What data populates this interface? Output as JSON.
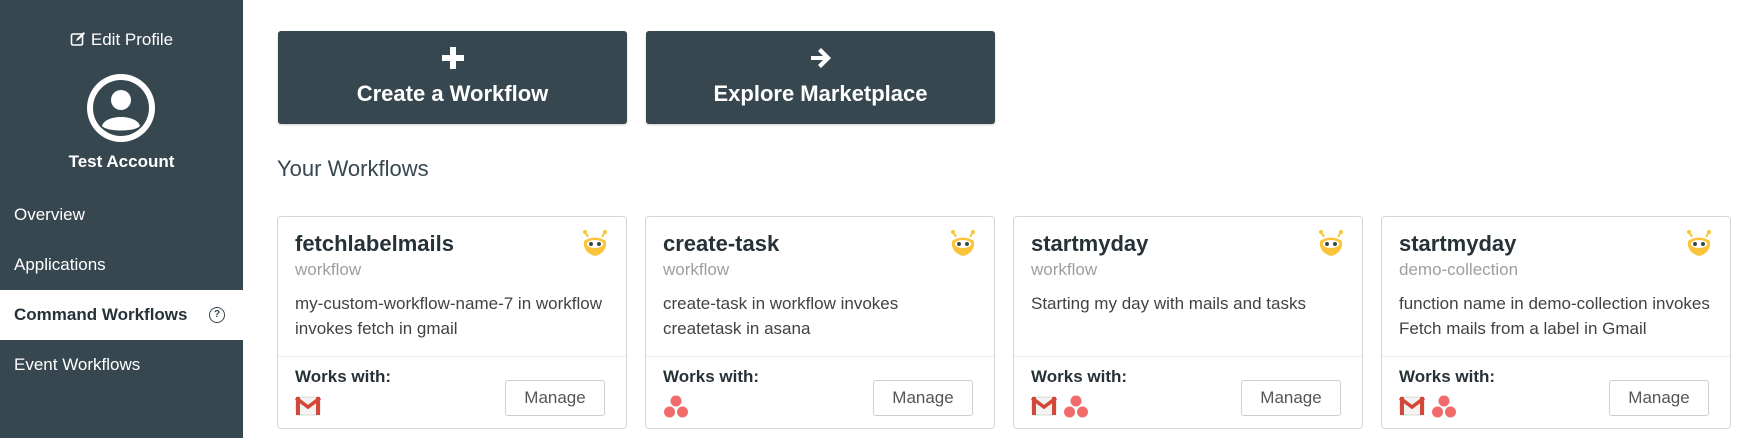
{
  "sidebar": {
    "edit_profile": "Edit Profile",
    "account_name": "Test Account",
    "items": [
      {
        "label": "Overview"
      },
      {
        "label": "Applications"
      },
      {
        "label": "Command Workflows",
        "active": true
      },
      {
        "label": "Event Workflows"
      }
    ],
    "help_glyph": "?"
  },
  "actions": {
    "create_label": "Create a Workflow",
    "explore_label": "Explore Marketplace"
  },
  "section_title": "Your Workflows",
  "workflows": [
    {
      "name": "fetchlabelmails",
      "collection": "workflow",
      "description": "my-custom-workflow-name-7 in workflow invokes fetch in gmail",
      "works_with_label": "Works with:",
      "apps": [
        "gmail-icon"
      ],
      "manage_label": "Manage"
    },
    {
      "name": "create-task",
      "collection": "workflow",
      "description": "create-task in workflow invokes createtask in asana",
      "works_with_label": "Works with:",
      "apps": [
        "asana-icon"
      ],
      "manage_label": "Manage"
    },
    {
      "name": "startmyday",
      "collection": "workflow",
      "description": "Starting my day with mails and tasks",
      "works_with_label": "Works with:",
      "apps": [
        "gmail-icon",
        "asana-icon"
      ],
      "manage_label": "Manage"
    },
    {
      "name": "startmyday",
      "collection": "demo-collection",
      "description": "function name in demo-collection invokes Fetch mails from a label in Gmail",
      "works_with_label": "Works with:",
      "apps": [
        "gmail-icon",
        "asana-icon"
      ],
      "manage_label": "Manage"
    }
  ],
  "colors": {
    "sidebar_bg": "#37474f",
    "button_bg": "#37474f",
    "bot_yellow": "#f9c43a",
    "asana_red": "#f06a6a",
    "gmail_red": "#d44638"
  }
}
